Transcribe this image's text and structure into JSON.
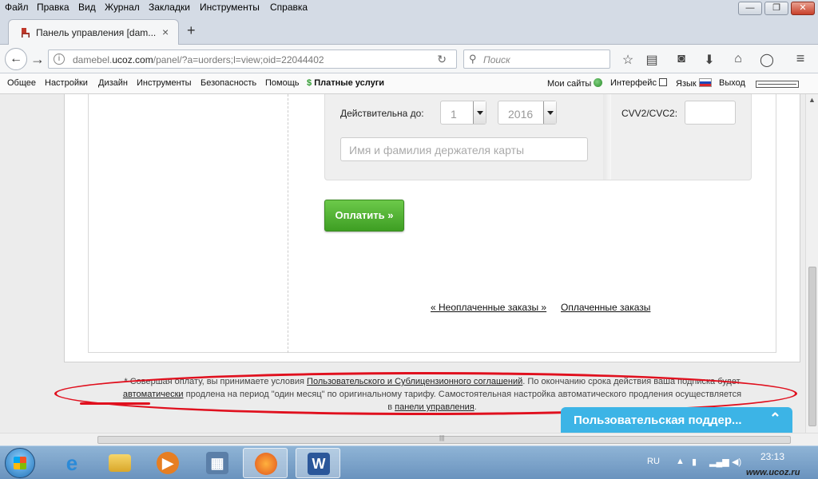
{
  "menu": [
    "Файл",
    "Правка",
    "Вид",
    "Журнал",
    "Закладки",
    "Инструменты",
    "Справка"
  ],
  "window_controls": {
    "minimize": "—",
    "maximize": "❐",
    "close": "✕"
  },
  "tab": {
    "title": "Панель управления [dam...",
    "close": "×",
    "new_tab": "+"
  },
  "nav": {
    "url_prefix": "damebel.",
    "url_host": "ucoz.com",
    "url_rest": "/panel/?a=uorders;l=view;oid=22044402",
    "search_placeholder": "Поиск"
  },
  "panel": {
    "items": [
      "Общее",
      "Настройки",
      "Дизайн",
      "Инструменты",
      "Безопасность",
      "Помощь"
    ],
    "paid": "Платные услуги",
    "my_sites": "Мои сайты",
    "interface": "Интерфейс",
    "language": "Язык",
    "logout": "Выход"
  },
  "form": {
    "valid_until_label": "Действительна до:",
    "month_value": "1",
    "year_value": "2016",
    "cvv_label": "CVV2/CVC2:",
    "cardholder_placeholder": "Имя и фамилия держателя карты"
  },
  "pay_button": "Оплатить »",
  "orders": {
    "unpaid": "« Неоплаченные заказы »",
    "paid": "Оплаченные заказы"
  },
  "notice": {
    "p1": "* Совершая оплату, вы принимаете условия ",
    "agreement_link": "Пользовательского и Сублицензионного соглашений",
    "p2": ". По окончанию срока действия ваша подписка будет",
    "auto_link": "автоматически",
    "p3": " продлена на период \"один месяц\" по оригинальному тарифу. Самостоятельная настройка автоматического продления осуществляется",
    "p4": "в ",
    "panel_link": "панели управления",
    "p5": "."
  },
  "support_widget": "Пользовательская поддер...",
  "taskbar": {
    "lang": "RU",
    "time": "23:13",
    "watermark": "www.ucoz.ru"
  },
  "colors": {
    "pay_green": "#4caf2d",
    "annotation_red": "#e0101e",
    "support_blue": "#3cb4e6"
  }
}
